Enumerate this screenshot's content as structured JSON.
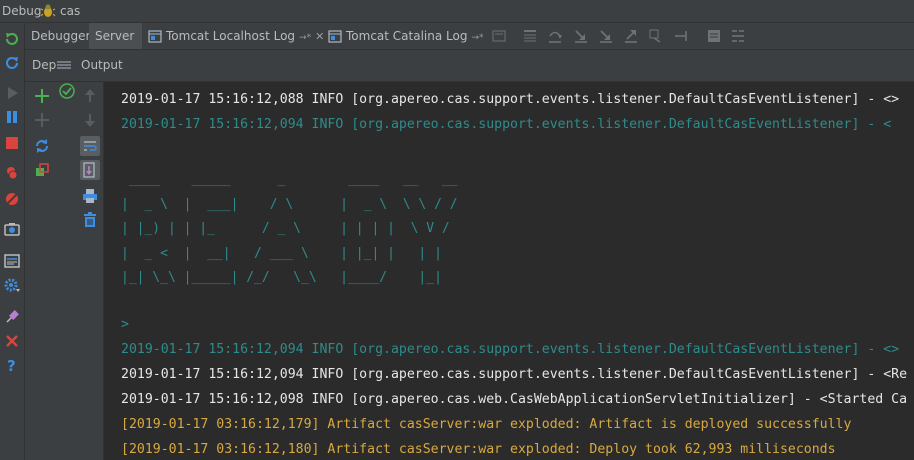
{
  "window": {
    "title": "Debug",
    "config_name": "cas"
  },
  "tabs": [
    {
      "label": "Debugger"
    },
    {
      "label": "Server"
    },
    {
      "label": "Tomcat Localhost Log"
    },
    {
      "label": "Tomcat Catalina Log"
    }
  ],
  "tab_pin": "→*",
  "tab_close": "✕",
  "subpanel": {
    "deployment_label": "Dep",
    "output_label": "Output"
  },
  "console": {
    "lines": [
      {
        "text": "2019-01-17 15:16:12,088 INFO [org.apereo.cas.support.events.listener.DefaultCasEventListener] - <>",
        "style": "normal"
      },
      {
        "text": "2019-01-17 15:16:12,094 INFO [org.apereo.cas.support.events.listener.DefaultCasEventListener] - <",
        "style": "banner"
      },
      {
        "text": ">",
        "style": "banner"
      },
      {
        "text": "2019-01-17 15:16:12,094 INFO [org.apereo.cas.support.events.listener.DefaultCasEventListener] - <>",
        "style": "banner"
      },
      {
        "text": "2019-01-17 15:16:12,094 INFO [org.apereo.cas.support.events.listener.DefaultCasEventListener] - <Re",
        "style": "normal"
      },
      {
        "text": "2019-01-17 15:16:12,098 INFO [org.apereo.cas.web.CasWebApplicationServletInitializer] - <Started Ca",
        "style": "normal"
      },
      {
        "text": "[2019-01-17 03:16:12,179] Artifact casServer:war exploded: Artifact is deployed successfully",
        "style": "artifact"
      },
      {
        "text": "[2019-01-17 03:16:12,180] Artifact casServer:war exploded: Deploy took 62,993 milliseconds",
        "style": "artifact"
      }
    ],
    "ascii_banner": " ____    _____      _        ____   __   __\n|  _ \\  |  ___|    / \\      |  _ \\  \\ \\ / /\n| |_) | | |_      / _ \\     | | | |  \\ V /\n|  _ <  |  __|   / ___ \\    | |_| |   | |\n|_| \\_\\ |_____| /_/   \\_\\   |____/    |_|"
  },
  "colors": {
    "background": "#2b2b2b",
    "panel": "#3c3f41",
    "normal_text": "#e6e6e6",
    "banner_text": "#2e8c8c",
    "artifact_text": "#d8a940"
  }
}
